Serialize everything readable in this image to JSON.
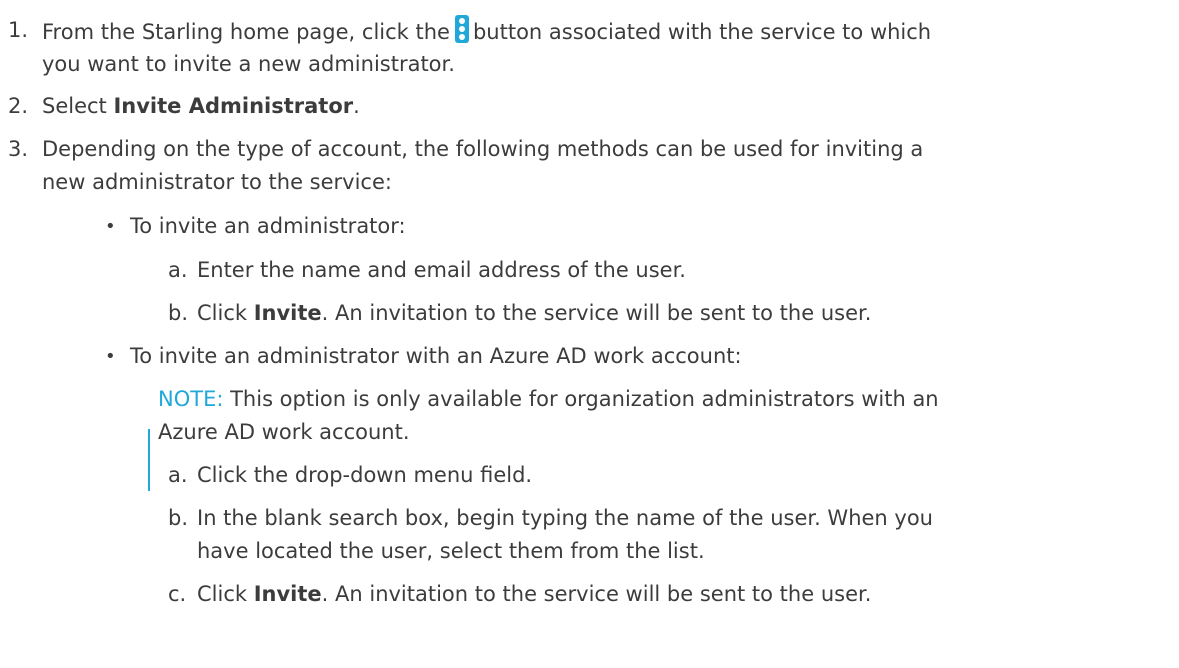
{
  "steps": [
    {
      "number": "1.",
      "line1_before": "From the Starling home page, click the",
      "icon": "more-vertical-icon",
      "line1_after": "button associated with the service to which",
      "line2": "you want to invite a new administrator."
    },
    {
      "number": "2.",
      "prefix": "Select ",
      "bold": "Invite Administrator",
      "suffix": "."
    },
    {
      "number": "3.",
      "line1": "Depending on the type of account, the following methods can be used for inviting a",
      "line2": "new administrator to the service:"
    }
  ],
  "method_1": {
    "bullet": "•",
    "title": "To invite an administrator:",
    "substeps": [
      {
        "letter": "a.",
        "text": "Enter the name and email address of the user."
      },
      {
        "letter": "b.",
        "prefix": "Click ",
        "bold": "Invite",
        "suffix": ". An invitation to the service will be sent to the user."
      }
    ]
  },
  "method_2": {
    "bullet": "•",
    "title": "To invite an administrator with an Azure AD work account:",
    "note": {
      "label": "NOTE:",
      "line1": " This option is only available for organization administrators with an",
      "line2": "Azure AD work account."
    },
    "substeps": [
      {
        "letter": "a.",
        "text": "Click the drop-down menu field."
      },
      {
        "letter": "b.",
        "line1": "In the blank search box, begin typing the name of the user. When you",
        "line2": "have located the user, select them from the list."
      },
      {
        "letter": "c.",
        "prefix": "Click ",
        "bold": "Invite",
        "suffix": ". An invitation to the service will be sent to the user."
      }
    ]
  },
  "colors": {
    "text": "#3c3c3c",
    "accent": "#1fa8d8"
  }
}
